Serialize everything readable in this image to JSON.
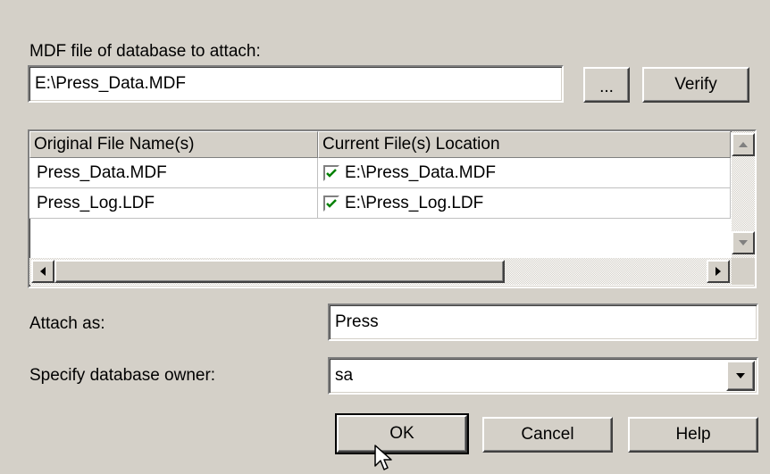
{
  "mdf": {
    "label": "MDF file of database to attach:",
    "path": "E:\\Press_Data.MDF",
    "browse_label": "...",
    "verify_label": "Verify"
  },
  "files_grid": {
    "headers": [
      "Original File Name(s)",
      "Current File(s) Location"
    ],
    "rows": [
      {
        "original": "Press_Data.MDF",
        "checked": true,
        "location": "E:\\Press_Data.MDF"
      },
      {
        "original": "Press_Log.LDF",
        "checked": true,
        "location": "E:\\Press_Log.LDF"
      }
    ]
  },
  "attach_as": {
    "label": "Attach as:",
    "value": "Press"
  },
  "owner": {
    "label": "Specify database owner:",
    "value": "sa"
  },
  "buttons": {
    "ok": "OK",
    "cancel": "Cancel",
    "help": "Help"
  },
  "icons": {
    "checkbox": "checkmark-icon",
    "dropdown": "triangle-down-icon",
    "scroll_up": "triangle-up-icon",
    "scroll_down": "triangle-down-icon",
    "scroll_left": "triangle-left-icon",
    "scroll_right": "triangle-right-icon",
    "cursor": "arrow-pointer-icon"
  },
  "colors": {
    "window_bg": "#d4d0c8",
    "check": "#008000"
  }
}
